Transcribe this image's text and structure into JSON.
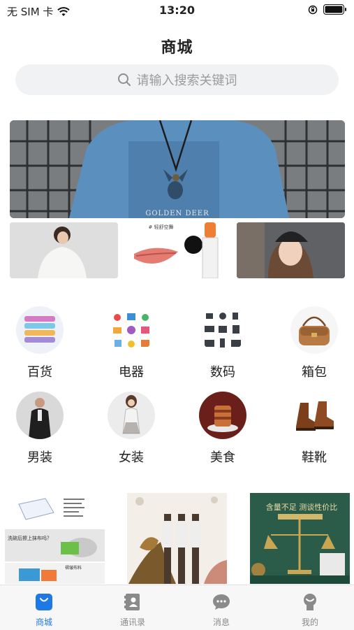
{
  "status_bar": {
    "carrier": "无 SIM 卡",
    "time": "13:20",
    "wifi_icon": "wifi-icon",
    "orientation_icon": "orientation-lock-icon",
    "battery_icon": "battery-icon"
  },
  "header": {
    "title": "商城"
  },
  "search": {
    "placeholder": "请输入搜索关键词",
    "icon": "search-icon"
  },
  "banner": {
    "hero_text": "GOLDEN DEER",
    "tile_center_text": "# 轻舒空舞"
  },
  "categories": [
    {
      "label": "百货",
      "icon": "towels-icon"
    },
    {
      "label": "电器",
      "icon": "appliances-icon"
    },
    {
      "label": "数码",
      "icon": "digital-devices-icon"
    },
    {
      "label": "箱包",
      "icon": "handbag-icon"
    },
    {
      "label": "男装",
      "icon": "menswear-icon"
    },
    {
      "label": "女装",
      "icon": "womenswear-icon"
    },
    {
      "label": "美食",
      "icon": "food-icon"
    },
    {
      "label": "鞋靴",
      "icon": "boots-icon"
    }
  ],
  "promos": {
    "left_caption": "洗碗后擦上抹布吗？",
    "left_caption2": "褶皱布料",
    "right_title": "含量不足 测谈性价比"
  },
  "tabbar": {
    "items": [
      {
        "label": "商城",
        "icon": "shop-bag-icon",
        "active": true
      },
      {
        "label": "通讯录",
        "icon": "contacts-icon",
        "active": false
      },
      {
        "label": "消息",
        "icon": "chat-icon",
        "active": false
      },
      {
        "label": "我的",
        "icon": "profile-icon",
        "active": false
      }
    ],
    "active_color": "#1e78e6",
    "inactive_color": "#8a8a8a"
  }
}
